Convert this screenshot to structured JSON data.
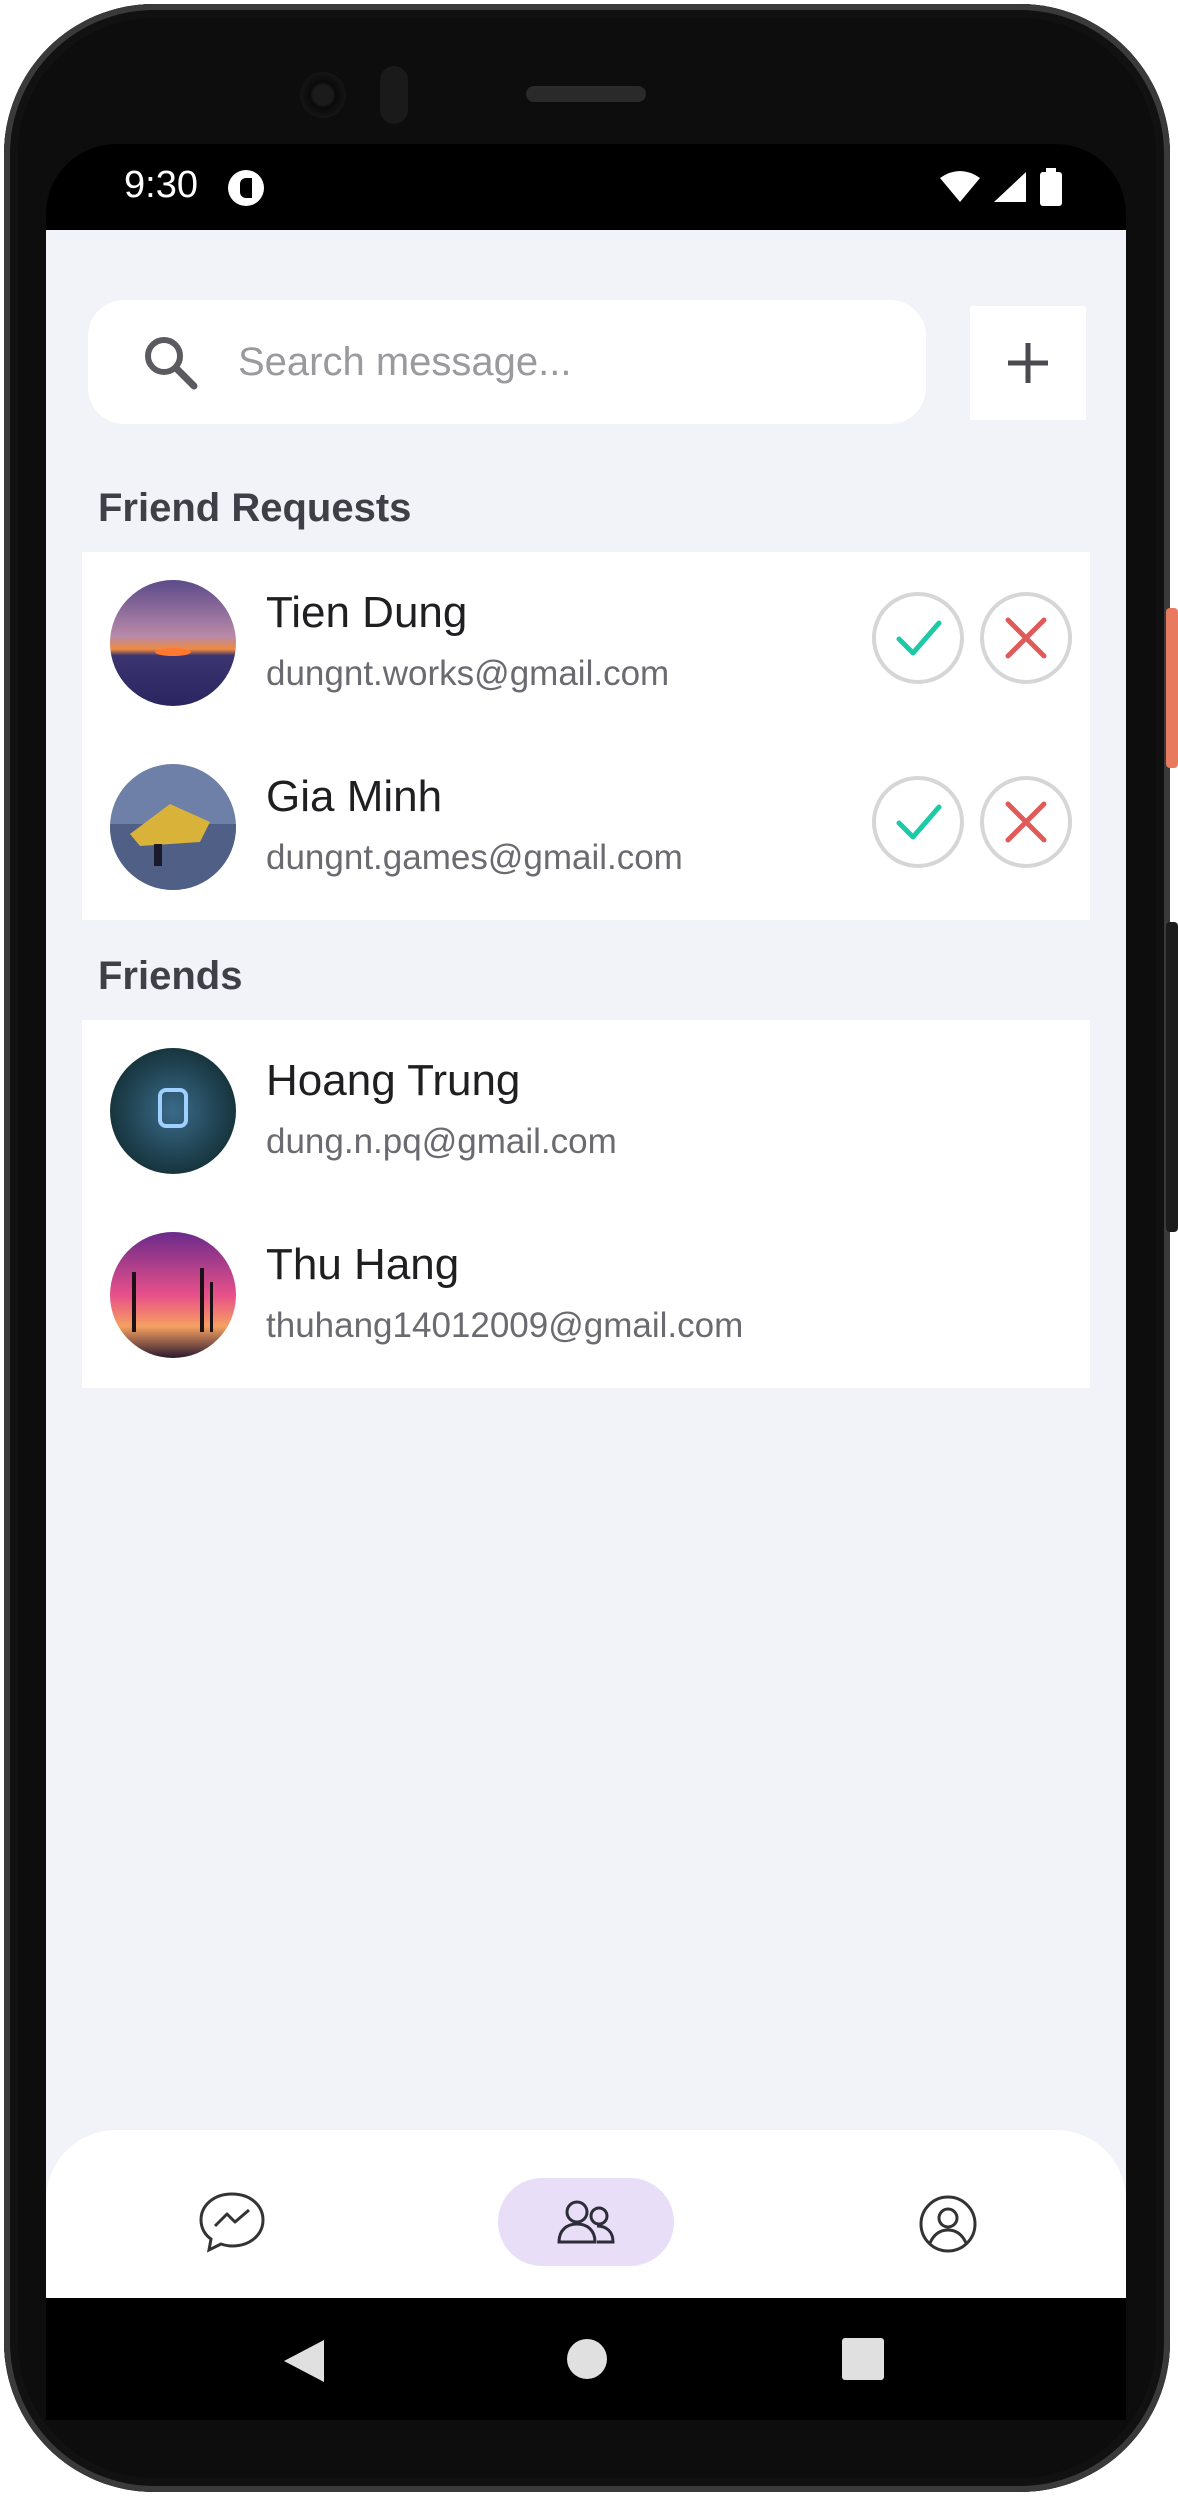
{
  "status_bar": {
    "time": "9:30",
    "icons": [
      "app-notification-icon",
      "wifi-icon",
      "signal-icon",
      "battery-icon"
    ]
  },
  "search": {
    "placeholder": "Search message..."
  },
  "add_button_icon": "plus-icon",
  "friend_requests": {
    "title": "Friend Requests",
    "items": [
      {
        "name": "Tien Dung",
        "email": "dungnt.works@gmail.com"
      },
      {
        "name": "Gia Minh",
        "email": "dungnt.games@gmail.com"
      }
    ]
  },
  "friends": {
    "title": "Friends",
    "items": [
      {
        "name": "Hoang Trung",
        "email": "dung.n.pq@gmail.com"
      },
      {
        "name": "Thu Hang",
        "email": "thuhang14012009@gmail.com"
      }
    ]
  },
  "bottom_nav": {
    "items": [
      {
        "icon": "messenger-icon",
        "active": false
      },
      {
        "icon": "friends-icon",
        "active": true
      },
      {
        "icon": "profile-icon",
        "active": false
      }
    ]
  },
  "colors": {
    "accent_accept": "#1ec9a6",
    "accent_decline": "#e05a5a",
    "active_nav_bg": "#e8def7",
    "screen_bg": "#f2f3f8"
  }
}
